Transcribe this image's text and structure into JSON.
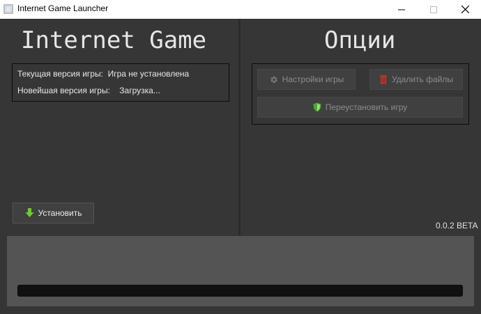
{
  "window": {
    "title": "Internet Game Launcher"
  },
  "left": {
    "heading": "Internet Game",
    "current_version_label": "Текущая версия игры:",
    "current_version_value": "Игра не установлена",
    "latest_version_label": "Новейшая версия игры:",
    "latest_version_value": "Загрузка...",
    "install_label": "Установить"
  },
  "right": {
    "heading": "Опции",
    "settings_label": "Настройки игры",
    "delete_label": "Удалить файлы",
    "reinstall_label": "Переустановить игру"
  },
  "version": "0.0.2 BETA",
  "progress": {
    "fraction": 0
  },
  "icons": {
    "settings": "gear-icon",
    "delete": "trash-icon",
    "reinstall": "shield-icon",
    "install": "download-arrow-icon"
  },
  "colors": {
    "accent_green": "#5fcf3c",
    "delete_red": "#c0392b"
  }
}
